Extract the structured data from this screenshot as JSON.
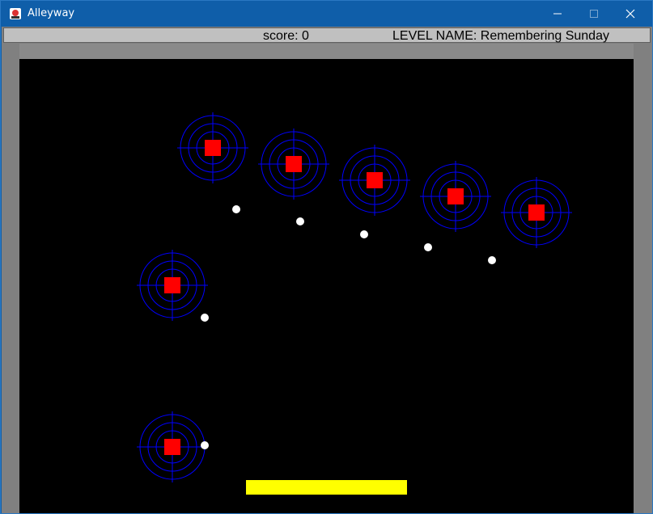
{
  "window": {
    "title": "Alleyway",
    "controls": {
      "minimize": "minimize-icon",
      "maximize": "maximize-icon",
      "close": "close-icon"
    }
  },
  "hud": {
    "score_text": "score: 0",
    "level_text": "LEVEL NAME: Remembering Sunday"
  },
  "game": {
    "block_count": 7,
    "ball_count": 7,
    "colors": {
      "background": "#000000",
      "block": "#ff0000",
      "target_rings": "#0000ff",
      "ball": "#ffffff",
      "paddle": "#ffff00",
      "walls": "#808080",
      "hud": "#c0c0c0"
    }
  }
}
